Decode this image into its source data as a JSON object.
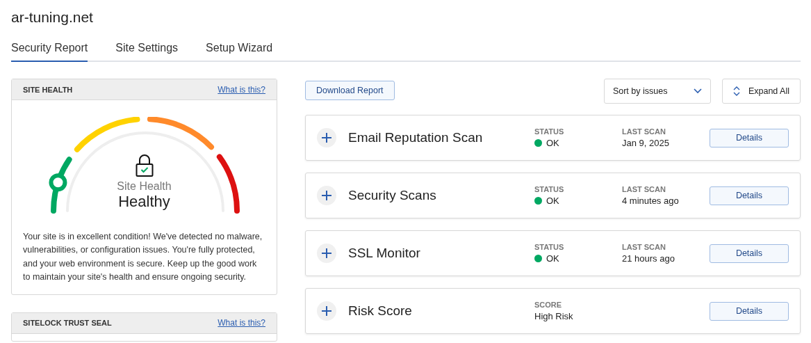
{
  "site_title": "ar-tuning.net",
  "tabs": [
    {
      "label": "Security Report",
      "selected": true
    },
    {
      "label": "Site Settings",
      "selected": false
    },
    {
      "label": "Setup Wizard",
      "selected": false
    }
  ],
  "site_health": {
    "heading": "SITE HEALTH",
    "link": "What is this?",
    "gauge_label": "Site Health",
    "gauge_value": "Healthy",
    "description": "Your site is in excellent condition! We've detected no malware, vulnerabilities, or configuration issues. You're fully protected, and your web environment is secure. Keep up the good work to maintain your site's health and ensure ongoing security."
  },
  "trust_seal": {
    "heading": "SITELOCK TRUST SEAL",
    "link": "What is this?"
  },
  "toolbar": {
    "download": "Download Report",
    "sort": "Sort by issues",
    "expand": "Expand All"
  },
  "scans": [
    {
      "kind": "status",
      "name": "Email Reputation Scan",
      "field_label": "STATUS",
      "field_value": "OK",
      "color": "#00a862",
      "date_label": "LAST SCAN",
      "date": "Jan 9, 2025",
      "button": "Details"
    },
    {
      "kind": "status",
      "name": "Security Scans",
      "field_label": "STATUS",
      "field_value": "OK",
      "color": "#00a862",
      "date_label": "LAST SCAN",
      "date": "4 minutes ago",
      "button": "Details"
    },
    {
      "kind": "status",
      "name": "SSL Monitor",
      "field_label": "STATUS",
      "field_value": "OK",
      "color": "#00a862",
      "date_label": "LAST SCAN",
      "date": "21 hours ago",
      "button": "Details"
    },
    {
      "kind": "score",
      "name": "Risk Score",
      "field_label": "SCORE",
      "field_value": "High Risk",
      "button": "Details"
    }
  ]
}
